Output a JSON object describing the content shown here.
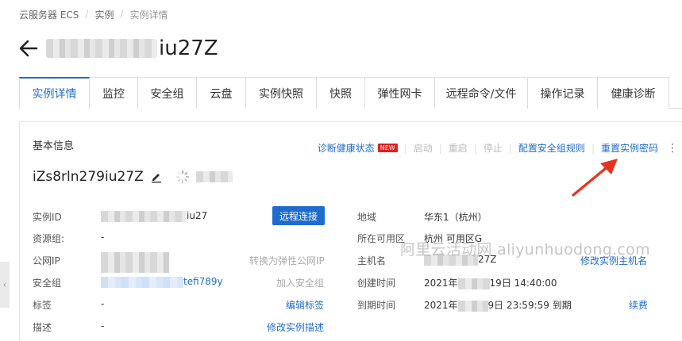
{
  "breadcrumb": [
    "云服务器 ECS",
    "实例",
    "实例详情"
  ],
  "title": {
    "suffix": "iu27Z"
  },
  "tabs": [
    "实例详情",
    "监控",
    "安全组",
    "云盘",
    "实例快照",
    "快照",
    "弹性网卡",
    "远程命令/文件",
    "操作记录",
    "健康诊断"
  ],
  "section_title": "基本信息",
  "actions": {
    "diagnose": "诊断健康状态",
    "new_badge": "NEW",
    "start": "启动",
    "restart": "重启",
    "stop": "停止",
    "config_sg": "配置安全组规则",
    "reset_pwd": "重置实例密码"
  },
  "instance_name": "iZs8rln279iu27Z",
  "left_fields": {
    "instance_id": {
      "label": "实例ID",
      "value_suffix": "iu27",
      "button": "远程连接"
    },
    "resource_group": {
      "label": "资源组:",
      "value": "-"
    },
    "public_ip": {
      "label": "公网IP",
      "action": "转换为弹性公网IP"
    },
    "security_group": {
      "label": "安全组",
      "value_suffix": "tefi789y",
      "action": "加入安全组"
    },
    "tags": {
      "label": "标签",
      "value": "-",
      "action": "编辑标签"
    },
    "description": {
      "label": "描述",
      "value": "-",
      "action": "修改实例描述"
    }
  },
  "right_fields": {
    "region": {
      "label": "地域",
      "value": "华东1（杭州）"
    },
    "zone": {
      "label": "所在可用区",
      "value": "杭州 可用区G"
    },
    "hostname": {
      "label": "主机名",
      "value_suffix": "27Z",
      "action": "修改实例主机名"
    },
    "created": {
      "label": "创建时间",
      "value_prefix": "2021年",
      "value_suffix": "19日 14:40:00"
    },
    "expires": {
      "label": "到期时间",
      "value_prefix": "2021年",
      "value_suffix": "9日 23:59:59 到期",
      "action": "续费"
    }
  },
  "watermark": "阿里云活动网 aliyunhuodong.com",
  "colors": {
    "accent": "#1f6bce",
    "annotation_arrow": "#e8321e",
    "badge": "#e02020"
  },
  "icons": [
    "back-arrow-icon",
    "edit-pencil-icon",
    "loading-spinner-icon",
    "more-vertical-icon",
    "chevron-left-icon",
    "red-annotation-arrow-icon"
  ]
}
